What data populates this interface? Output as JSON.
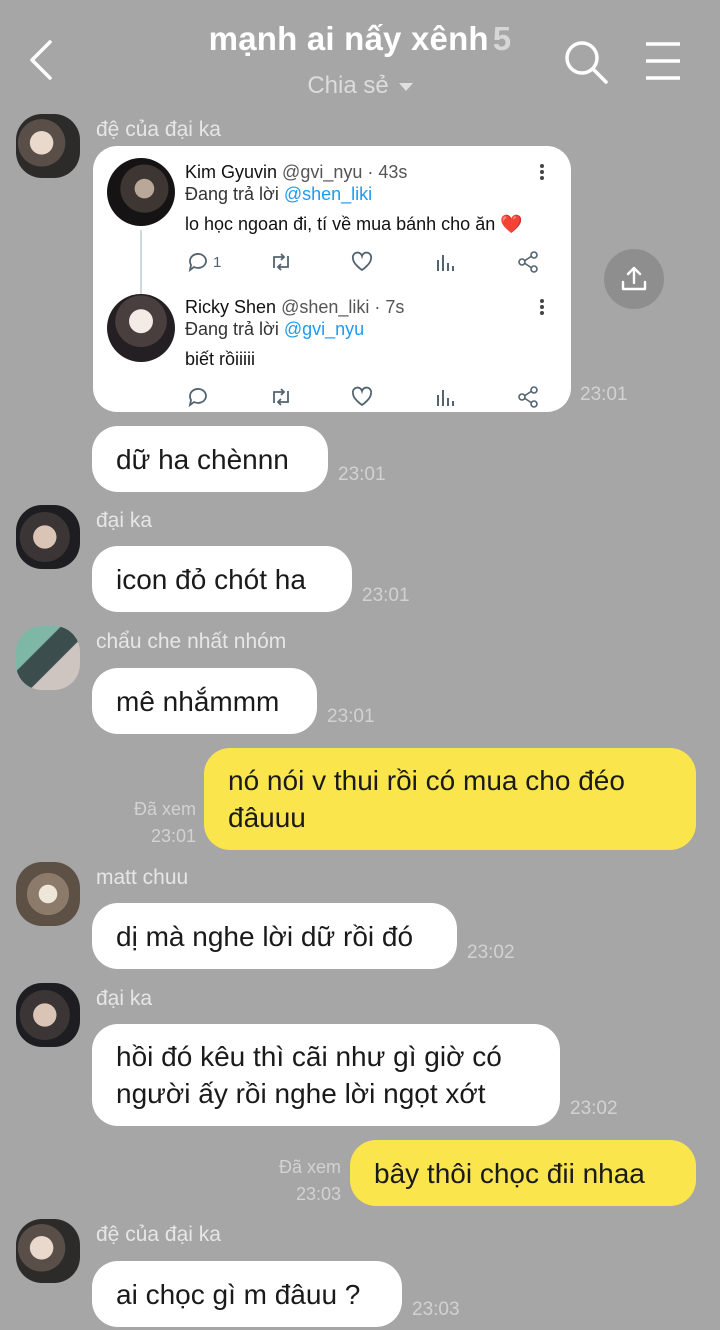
{
  "header": {
    "title": "mạnh ai nấy xênh",
    "member_count": "5",
    "subtitle": "Chia sẻ"
  },
  "tweet_card": {
    "tweets": [
      {
        "name": "Kim Gyuvin",
        "handle": "@gvi_nyu · 43s",
        "reply_prefix": "Đang trả lời",
        "reply_to": "@shen_liki",
        "text": "lo học ngoan đi, tí về mua bánh cho ăn ❤️",
        "reply_count": "1"
      },
      {
        "name": "Ricky Shen",
        "handle": "@shen_liki · 7s",
        "reply_prefix": "Đang trả lời",
        "reply_to": "@gvi_nyu",
        "text": "biết rồiiiii",
        "reply_count": ""
      }
    ]
  },
  "messages": [
    {
      "sender": "đệ của đại ka",
      "text": "dữ ha chènnn",
      "time": "23:01",
      "card_time": "23:01"
    },
    {
      "sender": "đại ka",
      "text": "icon đỏ chót ha",
      "time": "23:01"
    },
    {
      "sender": "chẩu che nhất nhóm",
      "text": "mê nhắmmm",
      "time": "23:01"
    },
    {
      "sender": "me",
      "text": "nó nói v thui rồi có mua cho đéo đâuuu",
      "time": "23:01",
      "status": "Đã xem"
    },
    {
      "sender": "matt chuu",
      "text": "dị mà nghe lời dữ rồi đó",
      "time": "23:02"
    },
    {
      "sender": "đại ka",
      "text": "hồi đó kêu thì cãi như gì giờ có người ấy rồi nghe lời ngọt xớt",
      "time": "23:02"
    },
    {
      "sender": "me",
      "text": "bây thôi chọc đii nhaa",
      "time": "23:03",
      "status": "Đã xem"
    },
    {
      "sender": "đệ của đại ka",
      "text": "ai chọc gì m đâuu ?",
      "time": "23:03"
    }
  ],
  "colors": {
    "background": "#a6a6a6",
    "incoming_bubble": "#ffffff",
    "outgoing_bubble": "#fbe54d",
    "mention": "#1d9bf0"
  }
}
